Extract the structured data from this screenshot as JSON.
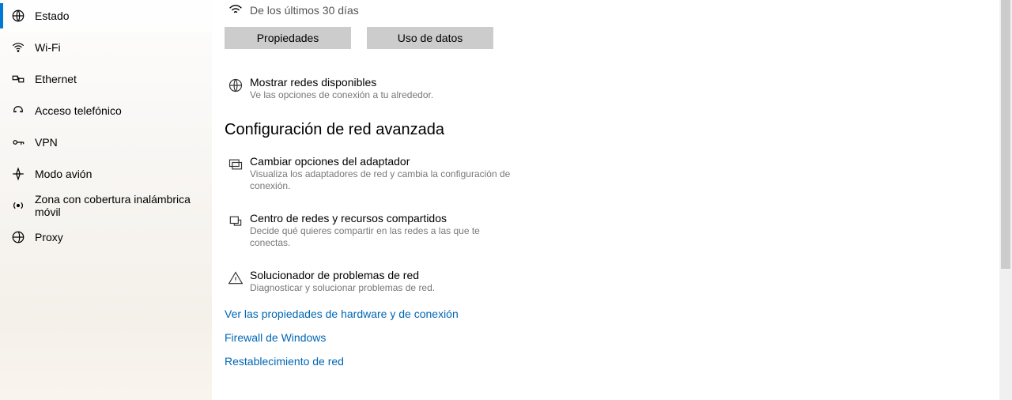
{
  "sidebar": {
    "items": [
      {
        "label": "Estado",
        "icon": "globe"
      },
      {
        "label": "Wi-Fi",
        "icon": "wifi"
      },
      {
        "label": "Ethernet",
        "icon": "ethernet"
      },
      {
        "label": "Acceso telefónico",
        "icon": "dialup"
      },
      {
        "label": "VPN",
        "icon": "vpn"
      },
      {
        "label": "Modo avión",
        "icon": "airplane"
      },
      {
        "label": "Zona con cobertura inalámbrica móvil",
        "icon": "hotspot"
      },
      {
        "label": "Proxy",
        "icon": "proxy"
      }
    ]
  },
  "main": {
    "status_subtitle": "De los últimos 30 días",
    "btn_properties": "Propiedades",
    "btn_usage": "Uso de datos",
    "show_networks": {
      "title": "Mostrar redes disponibles",
      "desc": "Ve las opciones de conexión a tu alrededor."
    },
    "section_header": "Configuración de red avanzada",
    "adapter": {
      "title": "Cambiar opciones del adaptador",
      "desc": "Visualiza los adaptadores de red y cambia la configuración de conexión."
    },
    "sharing": {
      "title": "Centro de redes y recursos compartidos",
      "desc": "Decide qué quieres compartir en las redes a las que te conectas."
    },
    "troubleshoot": {
      "title": "Solucionador de problemas de red",
      "desc": "Diagnosticar y solucionar problemas de red."
    },
    "link_hardware": "Ver las propiedades de hardware y de conexión",
    "link_firewall": "Firewall de Windows",
    "link_reset": "Restablecimiento de red"
  }
}
